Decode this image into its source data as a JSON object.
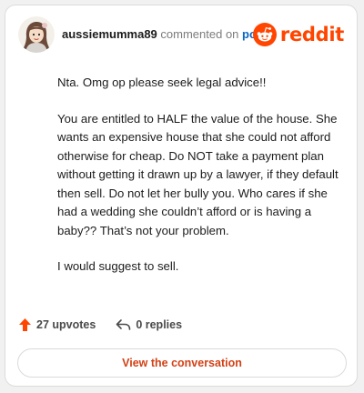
{
  "comment": {
    "username": "aussiemumma89",
    "action_text": "commented on",
    "post_link_text": "post",
    "paragraphs": [
      "Nta. Omg op please seek legal advice!!",
      "You are entitled to HALF the value of the house. She wants an expensive house that she could not afford otherwise for cheap. Do NOT take a payment plan without getting it drawn up by a lawyer, if they default then sell. Do not let her bully you. Who cares if she had a wedding she couldn’t afford or is having a baby?? That’s not your problem.",
      "I would suggest to sell."
    ]
  },
  "brand": {
    "wordmark": "reddit",
    "color": "#ff4500"
  },
  "footer": {
    "upvotes_text": "27 upvotes",
    "replies_text": "0 replies",
    "upvote_icon": "upvote-arrow-icon",
    "reply_icon": "reply-arrow-icon"
  },
  "actions": {
    "view_conversation_label": "View the conversation"
  },
  "colors": {
    "accent": "#ff4500",
    "link": "#0a66c2",
    "button_text": "#d24116"
  }
}
